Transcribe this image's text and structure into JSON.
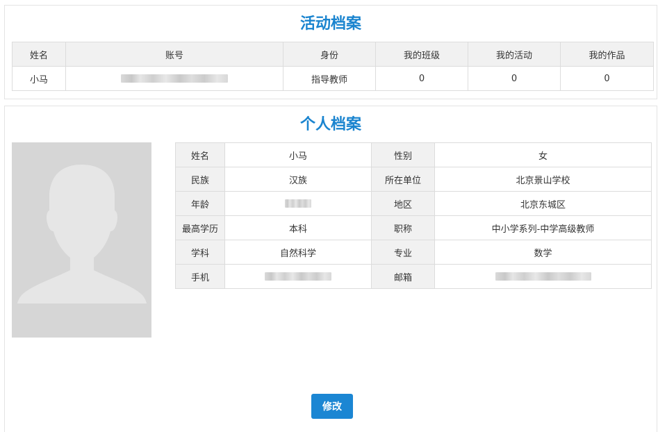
{
  "activity": {
    "title": "活动档案",
    "headers": [
      "姓名",
      "账号",
      "身份",
      "我的班级",
      "我的活动",
      "我的作品"
    ],
    "row": {
      "name": "小马",
      "identity": "指导教师",
      "classes": "0",
      "activities": "0",
      "works": "0"
    }
  },
  "personal": {
    "title": "个人档案",
    "fields": {
      "name_label": "姓名",
      "name_value": "小马",
      "gender_label": "性别",
      "gender_value": "女",
      "ethnicity_label": "民族",
      "ethnicity_value": "汉族",
      "unit_label": "所在单位",
      "unit_value": "北京景山学校",
      "age_label": "年龄",
      "region_label": "地区",
      "region_value": "北京东城区",
      "education_label": "最高学历",
      "education_value": "本科",
      "title_label": "职称",
      "title_value": "中小学系列-中学高级教师",
      "subject_label": "学科",
      "subject_value": "自然科学",
      "major_label": "专业",
      "major_value": "数学",
      "phone_label": "手机",
      "email_label": "邮箱"
    },
    "edit_label": "修改"
  },
  "colors": {
    "accent": "#1a84cf",
    "button": "#1b86d3",
    "header_bg": "#f1f1f1",
    "border": "#dcdcdc"
  },
  "icons": {
    "avatar": "user-silhouette-icon"
  }
}
